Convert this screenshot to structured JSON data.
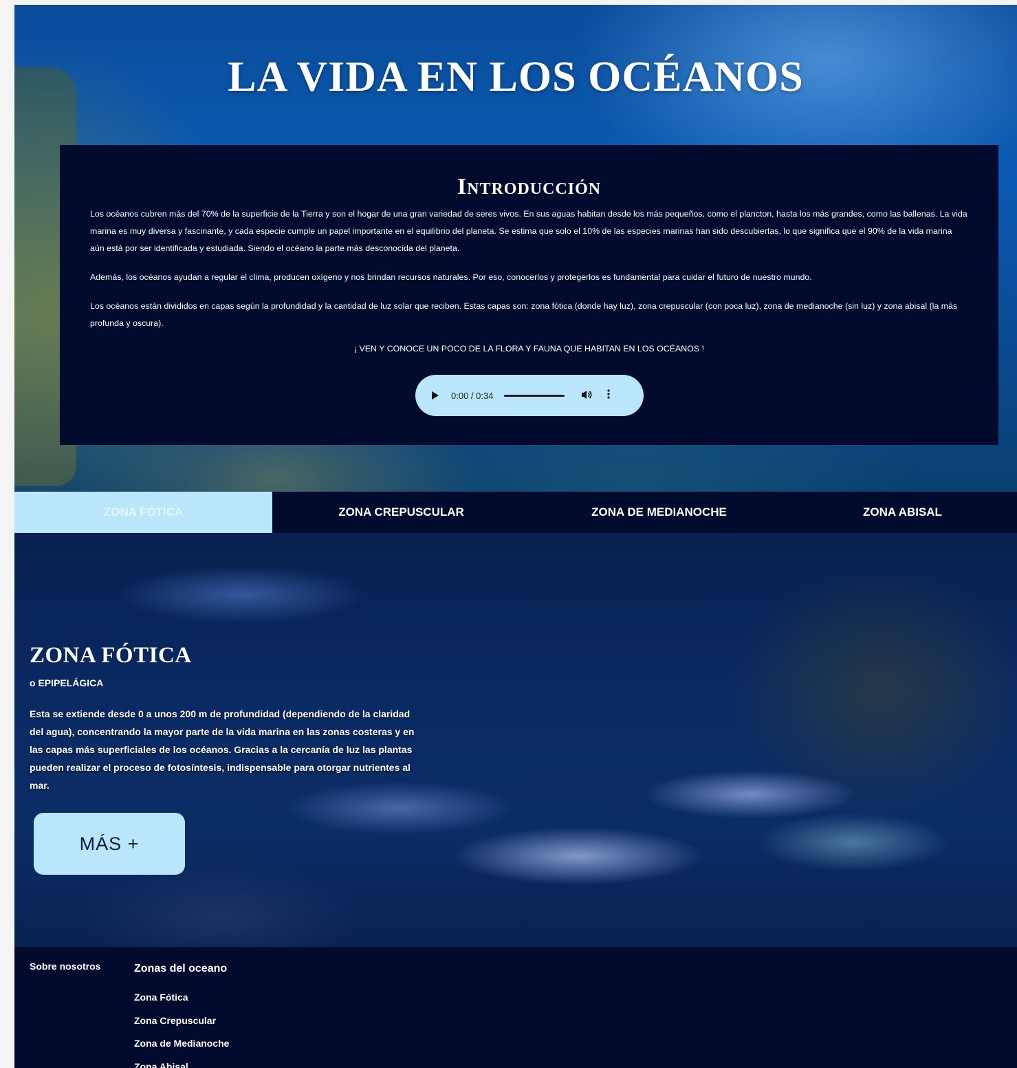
{
  "hero": {
    "title": "LA VIDA EN LOS OCÉANOS"
  },
  "intro": {
    "title": "Introducción",
    "paragraphs": [
      "Los océanos cubren más del 70% de la superficie de la Tierra y son el hogar de una gran variedad de seres vivos. En sus aguas habitan desde los más pequeños, como el plancton, hasta los más grandes, como las ballenas. La vida marina es muy diversa y fascinante, y cada especie cumple un papel importante en el equilibrio del planeta. Se estima que solo el 10% de las especies marinas han sido descubiertas, lo que significa que el 90% de la vida marina aún está por ser identificada y estudiada. Siendo el océano la parte más desconocida del planeta.",
      "Además, los océanos ayudan a regular el clima, producen oxígeno y nos brindan recursos naturales. Por eso, conocerlos y protegerlos es fundamental para cuidar el futuro de nuestro mundo.",
      "Los océanos están divididos en capas según la profundidad y la cantidad de luz solar que reciben. Estas capas son: zona fótica (donde hay luz), zona crepuscular (con poca luz), zona de medianoche (sin luz) y zona abisal (la más profunda y oscura)."
    ],
    "cta": "¡ VEN Y CONOCE UN POCO DE LA FLORA Y FAUNA QUE HABITAN EN LOS OCÉANOS !",
    "audio": {
      "time": "0:00 / 0:34",
      "play_icon": "play-icon",
      "volume_icon": "volume-icon",
      "menu_icon": "more-vertical-icon"
    }
  },
  "nav": {
    "tabs": [
      {
        "label": "ZONA FÓTICA",
        "active": true
      },
      {
        "label": "ZONA CREPUSCULAR",
        "active": false
      },
      {
        "label": "ZONA DE MEDIANOCHE",
        "active": false
      },
      {
        "label": "ZONA ABISAL",
        "active": false
      }
    ]
  },
  "zone": {
    "title": "ZONA FÓTICA",
    "subtitle": "o EPIPELÁGICA",
    "text": "Esta se extiende desde 0 a unos 200 m de profundidad (dependiendo de la claridad del agua), concentrando la mayor parte de la vida marina en las zonas costeras y en las capas más superficiales de los océanos. Gracias a la cercanía de luz las plantas pueden realizar el proceso de fotosíntesis, indispensable para otorgar nutrientes al mar.",
    "more_button": "MÁS +"
  },
  "footer": {
    "about": "Sobre nosotros",
    "zones_title": "Zonas del oceano",
    "zones": [
      "Zona Fótica",
      "Zona Crepuscular",
      "Zona de Medianoche",
      "Zona Abisal"
    ]
  },
  "colors": {
    "navy": "#020a2d",
    "accent": "#b9e6fb"
  }
}
